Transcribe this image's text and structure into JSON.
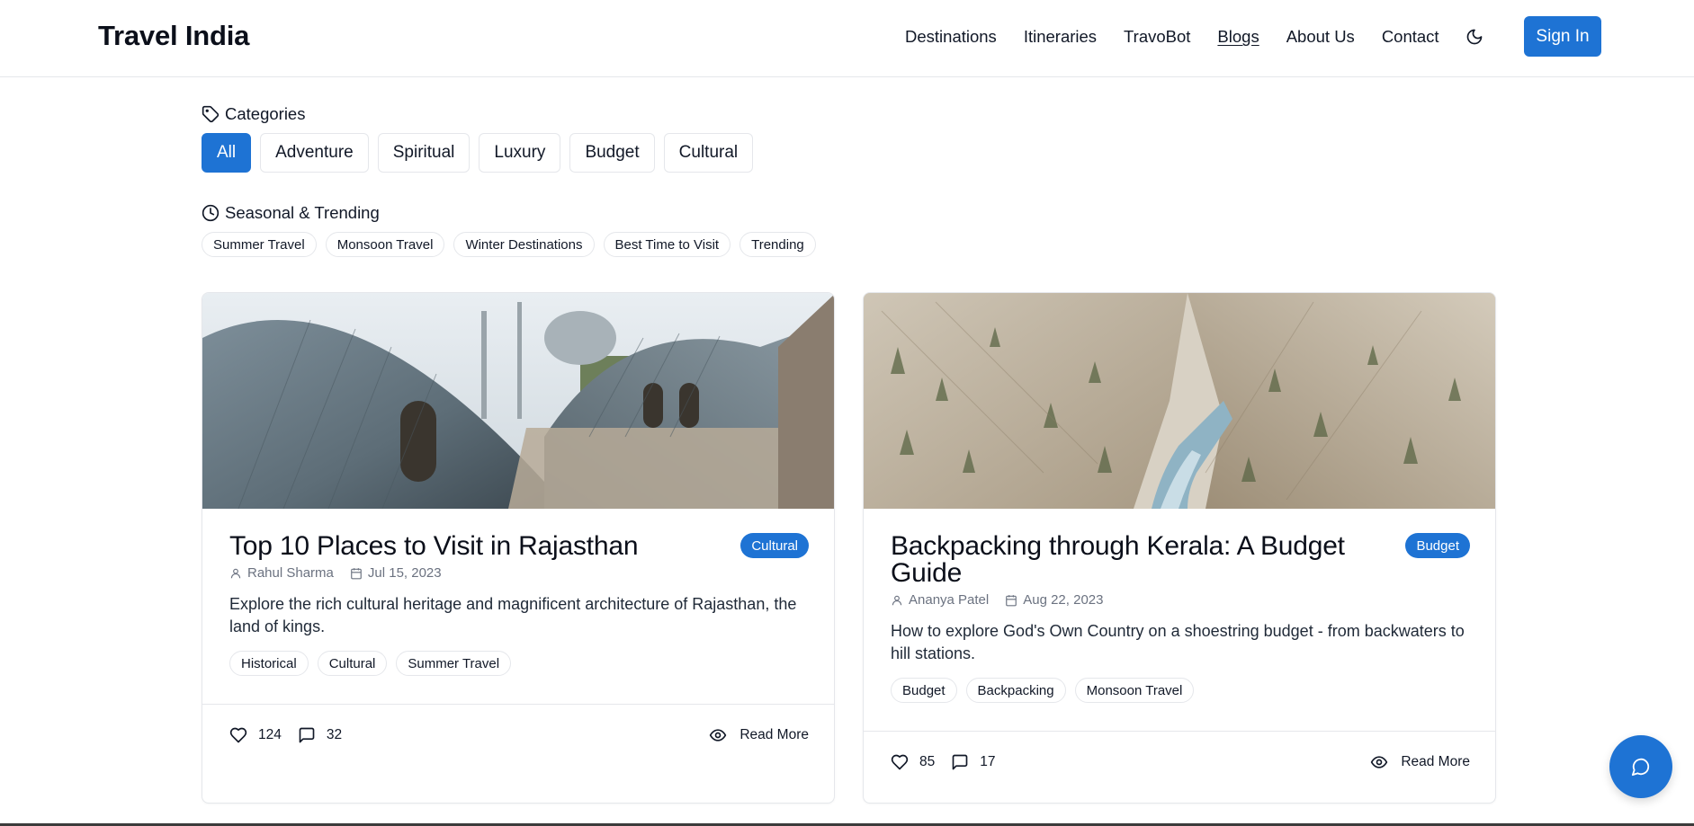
{
  "header": {
    "logo": "Travel India",
    "nav": [
      "Destinations",
      "Itineraries",
      "TravoBot",
      "Blogs",
      "About Us",
      "Contact"
    ],
    "active_nav": "Blogs",
    "sign_in": "Sign In",
    "theme_icon": "moon-icon"
  },
  "filters": {
    "categories_label": "Categories",
    "categories": [
      "All",
      "Adventure",
      "Spiritual",
      "Luxury",
      "Budget",
      "Cultural"
    ],
    "active_category": "All",
    "seasonal_label": "Seasonal & Trending",
    "seasonal": [
      "Summer Travel",
      "Monsoon Travel",
      "Winter Destinations",
      "Best Time to Visit",
      "Trending"
    ]
  },
  "posts": [
    {
      "title": "Top 10 Places to Visit in Rajasthan",
      "category": "Cultural",
      "author": "Rahul Sharma",
      "date": "Jul 15, 2023",
      "description": "Explore the rich cultural heritage and magnificent architecture of Rajasthan, the land of kings.",
      "tags": [
        "Historical",
        "Cultural",
        "Summer Travel"
      ],
      "likes": "124",
      "comments": "32",
      "read_more": "Read More"
    },
    {
      "title": "Backpacking through Kerala: A Budget Guide",
      "category": "Budget",
      "author": "Ananya Patel",
      "date": "Aug 22, 2023",
      "description": "How to explore God's Own Country on a shoestring budget - from backwaters to hill stations.",
      "tags": [
        "Budget",
        "Backpacking",
        "Monsoon Travel"
      ],
      "likes": "85",
      "comments": "17",
      "read_more": "Read More"
    }
  ],
  "colors": {
    "accent": "#1e73d4",
    "border": "#e5e7eb",
    "muted_text": "#6b7280"
  },
  "chat_icon": "chat-bubble-icon"
}
